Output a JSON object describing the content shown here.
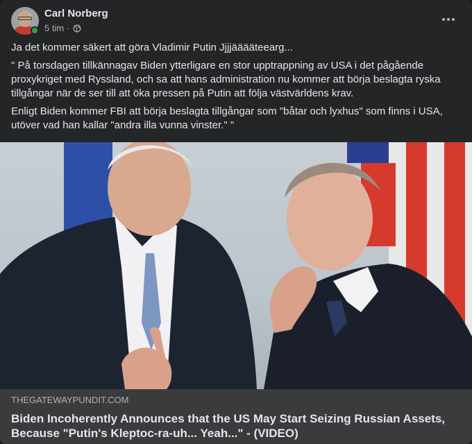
{
  "author": {
    "name": "Carl Norberg",
    "time": "5 tim",
    "separator": "·",
    "privacy_icon": "globe-icon",
    "online": true
  },
  "post": {
    "paragraphs": [
      "Ja det kommer säkert att göra Vladimir Putin Jjjjääääteearg...",
      "\" På torsdagen tillkännagav Biden ytterligare en stor upptrappning av USA i det pågående proxykriget med Ryssland, och sa att hans administration nu kommer att börja beslagta ryska tillgångar när de ser till att öka pressen på Putin att följa västvärldens krav.",
      "Enligt Biden kommer FBI att börja beslagta tillgångar som \"båtar och lyxhus\" som finns i USA, utöver vad han kallar \"andra illa vunna vinster.\" \""
    ]
  },
  "link": {
    "domain": "THEGATEWAYPUNDIT.COM",
    "title": "Biden Incoherently Announces that the US May Start Seizing Russian Assets, Because \"Putin's Kleptoc-ra-uh... Yeah...\" - (VIDEO)"
  },
  "colors": {
    "card_bg": "#242526",
    "preview_bg": "#3a3b3c",
    "text_primary": "#e4e6eb",
    "text_secondary": "#b0b3b8",
    "online_green": "#31a24c"
  }
}
